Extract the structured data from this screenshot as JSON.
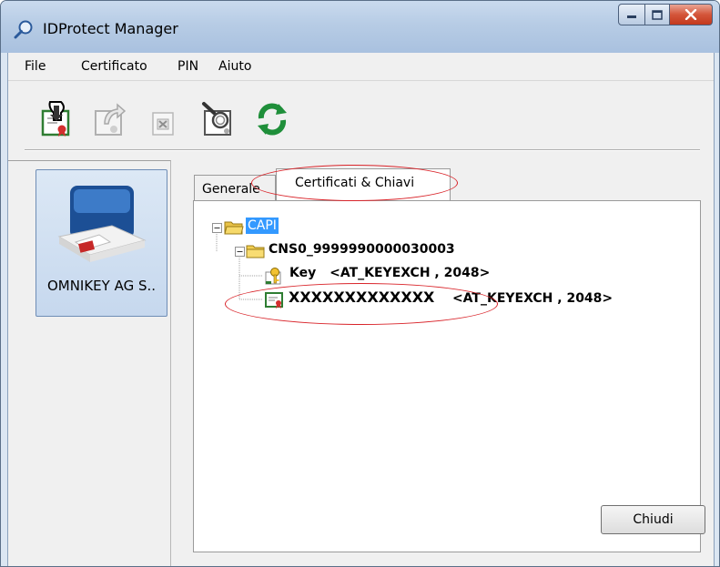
{
  "window": {
    "title": "IDProtect Manager"
  },
  "menu": {
    "items": [
      "File",
      "Certificato",
      "PIN",
      "Aiuto"
    ]
  },
  "toolbar": {
    "buttons": [
      {
        "icon": "import-certificate-icon",
        "enabled": true
      },
      {
        "icon": "export-certificate-icon",
        "enabled": false
      },
      {
        "icon": "delete-certificate-icon",
        "enabled": false
      },
      {
        "icon": "view-certificate-icon",
        "enabled": true
      },
      {
        "icon": "refresh-icon",
        "enabled": true
      }
    ]
  },
  "reader": {
    "label": "OMNIKEY AG S.."
  },
  "tabs": [
    {
      "label": "Generale",
      "active": false
    },
    {
      "label": "Certificati & Chiavi",
      "active": true
    }
  ],
  "tree": {
    "root": {
      "label": "CAPI",
      "selected": true
    },
    "container": {
      "label": "CNS0_9999990000030003"
    },
    "key": {
      "name": "Key",
      "info": "<AT_KEYEXCH , 2048>"
    },
    "certificate": {
      "name": "XXXXXXXXXXXXX",
      "info": "<AT_KEYEXCH , 2048>"
    }
  },
  "actions": {
    "close_label": "Chiudi"
  },
  "colors": {
    "selection": "#3399ff",
    "annotation": "#d9242a",
    "title_bar": "#b7cce5",
    "close_button": "#c3391d"
  }
}
